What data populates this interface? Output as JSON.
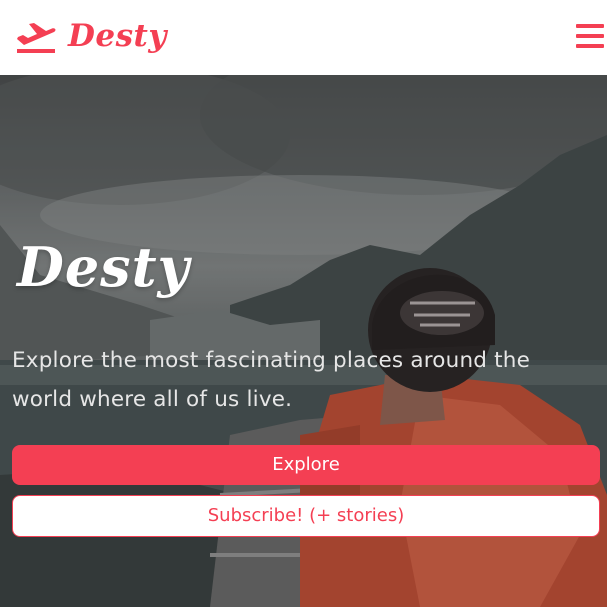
{
  "brand": {
    "name": "Desty",
    "icon": "airplane-takeoff-icon"
  },
  "nav": {
    "menu_icon": "hamburger-menu-icon"
  },
  "hero": {
    "title": "Desty",
    "text": "Explore the most fascinating places around the world where all of us live.",
    "explore_label": "Explore",
    "subscribe_label": "Subscribe! (+ stories)"
  },
  "colors": {
    "accent": "#f43f53",
    "background": "#ffffff",
    "hero_text": "#e6e6e6"
  }
}
